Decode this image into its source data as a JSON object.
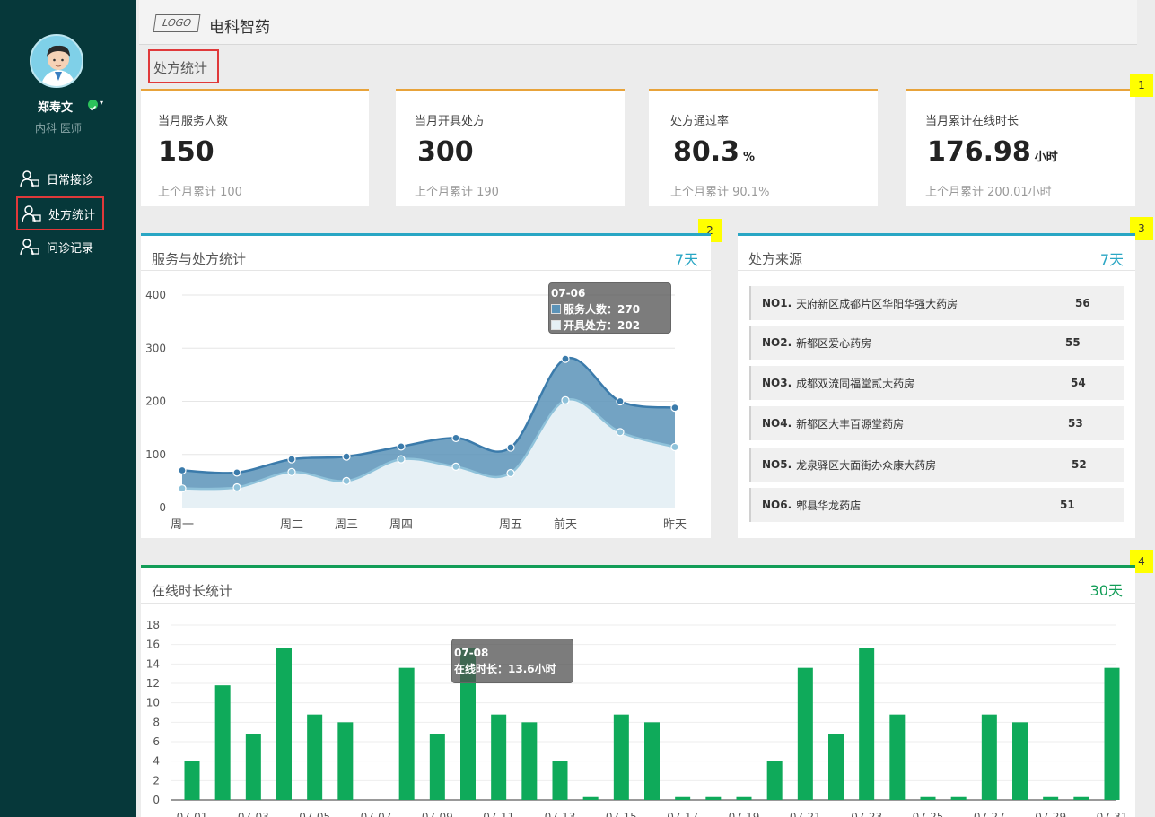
{
  "user": {
    "name": "郑寿文",
    "role": "内科 医师"
  },
  "sidebar": {
    "items": [
      {
        "label": "日常接诊"
      },
      {
        "label": "处方统计"
      },
      {
        "label": "问诊记录"
      }
    ]
  },
  "header": {
    "logo_text": "LOGO",
    "app_title": "电科智药"
  },
  "page_title": "处方统计",
  "stats": [
    {
      "label": "当月服务人数",
      "value": "150",
      "unit": "",
      "sub": "上个月累计 100"
    },
    {
      "label": "当月开具处方",
      "value": "300",
      "unit": "",
      "sub": "上个月累计 190"
    },
    {
      "label": "处方通过率",
      "value": "80.3",
      "unit": "%",
      "sub": "上个月累计  90.1%"
    },
    {
      "label": "当月累计在线时长",
      "value": "176.98",
      "unit": "小时",
      "sub": "上个月累计  200.01小时"
    }
  ],
  "tags": [
    "1",
    "2",
    "3",
    "4"
  ],
  "service_panel": {
    "title": "服务与处方统计",
    "range": "7天",
    "tooltip": {
      "date": "07-06",
      "line1": "服务人数：270",
      "line2": "开具处方：202"
    }
  },
  "source_panel": {
    "title": "处方来源",
    "range": "7天",
    "items": [
      {
        "rank": "NO1.",
        "name": "天府新区成都片区华阳华强大药房",
        "count": "56"
      },
      {
        "rank": "NO2.",
        "name": "新都区爱心药房",
        "count": "55"
      },
      {
        "rank": "NO3.",
        "name": "成都双流同福堂贰大药房",
        "count": "54"
      },
      {
        "rank": "NO4.",
        "name": "新都区大丰百源堂药房",
        "count": "53"
      },
      {
        "rank": "NO5.",
        "name": "龙泉驿区大面街办众康大药房",
        "count": "52"
      },
      {
        "rank": "NO6.",
        "name": "郫县华龙药店",
        "count": "51"
      }
    ]
  },
  "online_panel": {
    "title": "在线时长统计",
    "range": "30天",
    "tooltip": {
      "date": "07-08",
      "line1": "在线时长：13.6小时"
    }
  },
  "colors": {
    "sidebar_bg": "#06383a",
    "stat_accent": "#e8a33a",
    "service_accent": "#29a6c4",
    "online_accent": "#129d57",
    "bar": "#0faa5a",
    "area_dark": "#5b93b8",
    "area_light": "#e6f0f5"
  },
  "chart_data": [
    {
      "type": "area",
      "categories": [
        "周一",
        "周二",
        "周三",
        "周四",
        "周五",
        "前天",
        "昨天"
      ],
      "x_points": [
        "周一",
        "",
        "周二",
        "周三",
        "周四",
        "",
        "周五",
        "前天",
        "",
        "昨天"
      ],
      "series": [
        {
          "name": "服务人数",
          "values": [
            70,
            66,
            91,
            96,
            115,
            131,
            113,
            280,
            200,
            188
          ]
        },
        {
          "name": "开具处方",
          "values": [
            36,
            38,
            67,
            50,
            91,
            77,
            65,
            202,
            142,
            114
          ]
        }
      ],
      "yticks": [
        0,
        100,
        200,
        300,
        400
      ],
      "ylim": [
        0,
        400
      ],
      "grid": true
    },
    {
      "type": "bar",
      "categories": [
        "07-01",
        "07-02",
        "07-03",
        "07-04",
        "07-05",
        "07-06",
        "07-07",
        "07-08",
        "07-09",
        "07-10",
        "07-11",
        "07-12",
        "07-13",
        "07-14",
        "07-15",
        "07-16",
        "07-17",
        "07-18",
        "07-19",
        "07-20",
        "07-21",
        "07-22",
        "07-23",
        "07-24",
        "07-25",
        "07-26",
        "07-27",
        "07-28",
        "07-29",
        "07-30",
        "07-31"
      ],
      "xtick_labels": [
        "07-01",
        "07-03",
        "07-05",
        "07-07",
        "07-09",
        "07-11",
        "07-13",
        "07-15",
        "07-17",
        "07-19",
        "07-21",
        "07-23",
        "07-25",
        "07-27",
        "07-29",
        "07-31"
      ],
      "values": [
        4,
        11.8,
        6.8,
        15.6,
        8.8,
        8,
        0,
        13.6,
        6.8,
        15.6,
        8.8,
        8,
        4,
        0.3,
        8.8,
        8,
        0.3,
        0.3,
        0.3,
        4,
        13.6,
        6.8,
        15.6,
        8.8,
        0.3,
        0.3,
        8.8,
        8,
        0.3,
        0.3,
        13.6
      ],
      "yticks": [
        0,
        2,
        4,
        6,
        8,
        10,
        12,
        14,
        16,
        18
      ],
      "ylim": [
        0,
        18
      ],
      "grid": true
    }
  ]
}
